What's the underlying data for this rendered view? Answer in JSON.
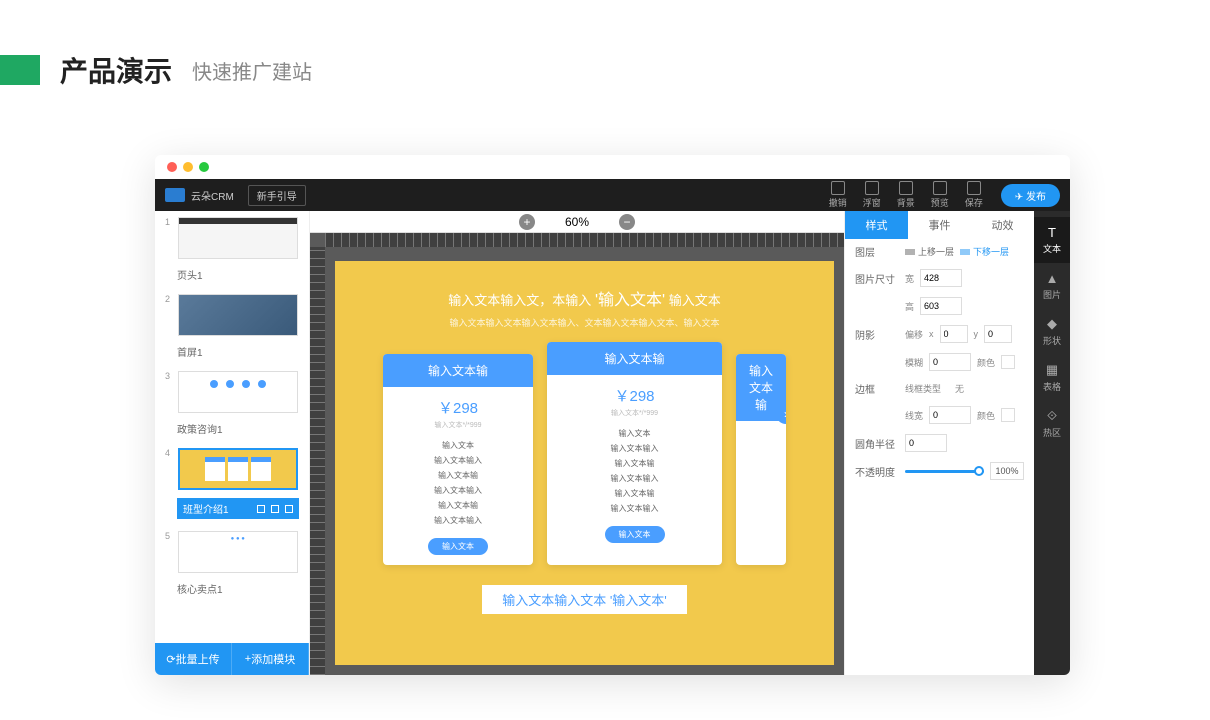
{
  "header": {
    "title": "产品演示",
    "subtitle": "快速推广建站"
  },
  "topbar": {
    "brand": "云朵CRM",
    "guide": "新手引导",
    "actions": {
      "undo": "撤销",
      "float": "浮窗",
      "bg": "背景",
      "preview": "预览",
      "save": "保存"
    },
    "publish": "发布"
  },
  "slides": [
    {
      "num": "1",
      "label": "页头1"
    },
    {
      "num": "2",
      "label": "首屏1"
    },
    {
      "num": "3",
      "label": "政策咨询1"
    },
    {
      "num": "4",
      "label": "班型介绍1"
    },
    {
      "num": "5",
      "label": "核心卖点1"
    }
  ],
  "left_footer": {
    "batch": "批量上传",
    "add": "添加模块"
  },
  "zoom": {
    "value": "60%"
  },
  "canvas": {
    "title_pre": "输入文本输入文，本输入",
    "title_hl": "'输入文本'",
    "title_post": "输入文本",
    "subtitle": "输入文本输入文本输入文本输入、文本输入文本输入文本、输入文本",
    "card1": {
      "head": "输入文本输",
      "price": "￥298",
      "pricesub": "输入文本*/*999",
      "feats": [
        "输入文本",
        "输入文本输入",
        "输入文本输",
        "输入文本输入",
        "输入文本输",
        "输入文本输入"
      ],
      "btn": "输入文本"
    },
    "card2": {
      "head": "输入文本输",
      "price": "￥298",
      "pricesub": "输入文本*/*999",
      "feats": [
        "输入文本",
        "输入文本输入",
        "输入文本输",
        "输入文本输入",
        "输入文本输",
        "输入文本输入"
      ],
      "btn": "输入文本"
    },
    "card3": {
      "head": "输入文本输"
    },
    "bottom_pre": "输入文本输入文本",
    "bottom_hl": "'输入文本'"
  },
  "tabs": {
    "style": "样式",
    "event": "事件",
    "effect": "动效"
  },
  "props": {
    "layer": "图层",
    "up": "上移一层",
    "down": "下移一层",
    "size": "图片尺寸",
    "w": "宽",
    "w_val": "428",
    "h": "高",
    "h_val": "603",
    "shadow": "阴影",
    "offset": "偏移",
    "x": "x",
    "x_val": "0",
    "y": "y",
    "y_val": "0",
    "blur": "模糊",
    "blur_val": "0",
    "color": "颜色",
    "border": "边框",
    "line_type": "线框类型",
    "line_type_val": "无",
    "line_w": "线宽",
    "line_w_val": "0",
    "radius": "圆角半径",
    "radius_val": "0",
    "opacity": "不透明度",
    "opacity_val": "100%"
  },
  "tools": {
    "text": "文本",
    "image": "图片",
    "shape": "形状",
    "table": "表格",
    "hotzone": "热区"
  }
}
